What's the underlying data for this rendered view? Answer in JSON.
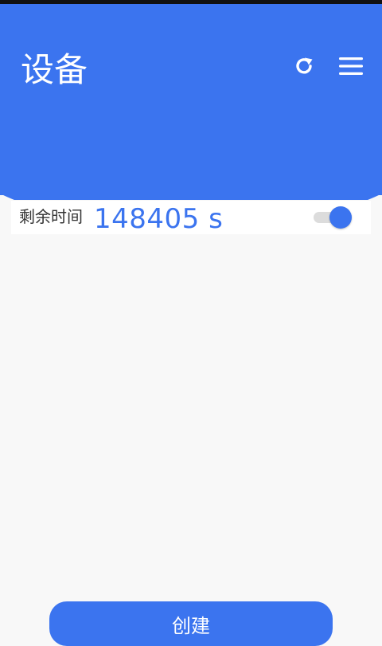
{
  "header": {
    "title": "设备",
    "refresh_icon": "refresh-icon",
    "menu_icon": "menu-icon"
  },
  "device_card": {
    "remaining_label": "剩余时间",
    "remaining_value": "148405 s",
    "toggle_on": true
  },
  "footer": {
    "create_label": "创建"
  },
  "colors": {
    "accent": "#3b74ef",
    "background": "#f8f8f8",
    "card": "#ffffff",
    "toggle_track": "#dcdcdc"
  }
}
